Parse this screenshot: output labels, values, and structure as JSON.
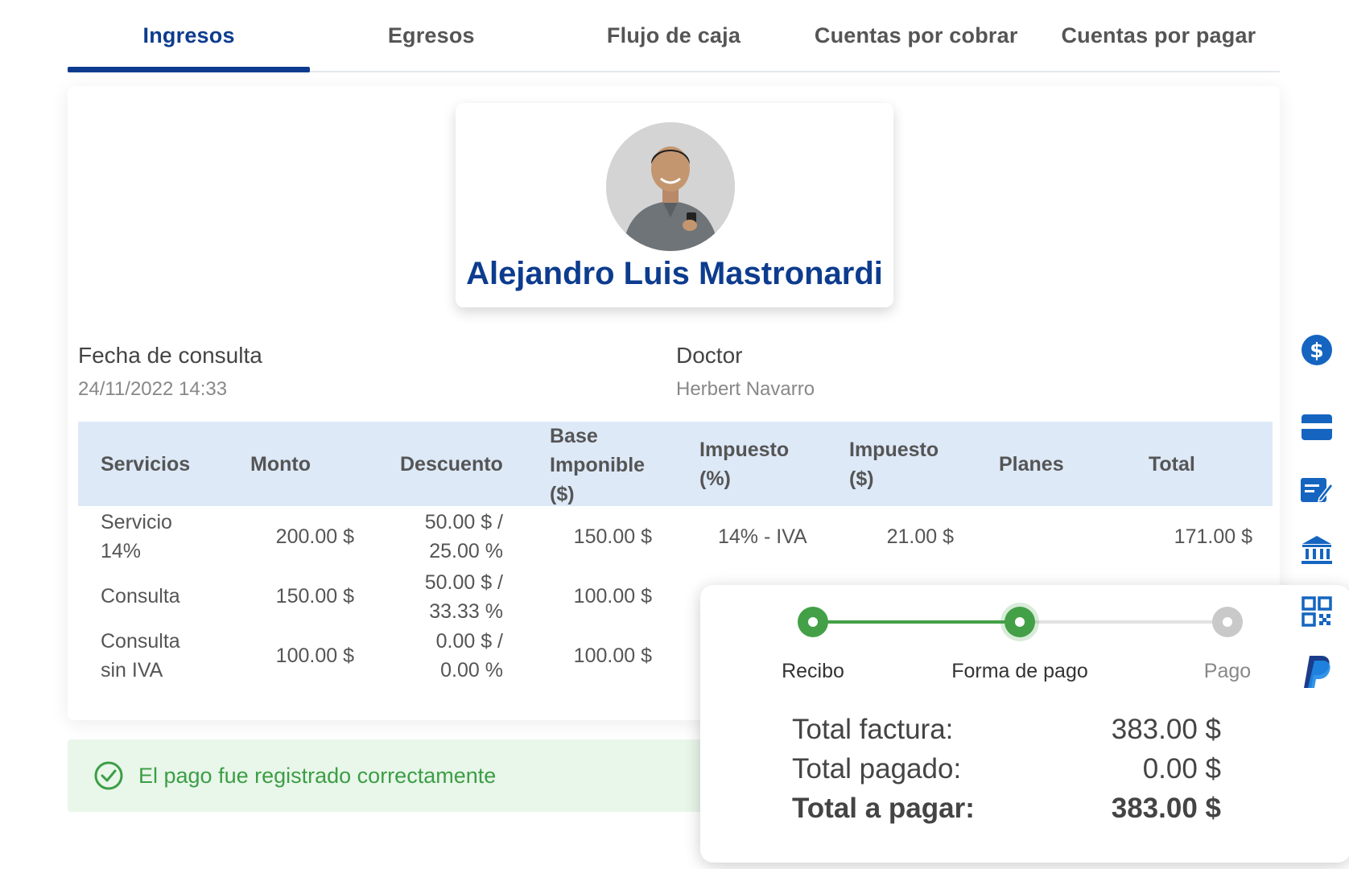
{
  "tabs": [
    {
      "label": "Ingresos",
      "active": true
    },
    {
      "label": "Egresos"
    },
    {
      "label": "Flujo de caja"
    },
    {
      "label": "Cuentas por cobrar"
    },
    {
      "label": "Cuentas por pagar"
    }
  ],
  "patient": {
    "name": "Alejandro Luis Mastronardi"
  },
  "consulta": {
    "fecha_label": "Fecha de consulta",
    "fecha_value": "24/11/2022 14:33",
    "doctor_label": "Doctor",
    "doctor_value": "Herbert Navarro"
  },
  "table": {
    "headers": {
      "servicios": "Servicios",
      "monto": "Monto",
      "descuento": "Descuento",
      "base_1": "Base",
      "base_2": "Imponible",
      "base_3": "($)",
      "imp_pct_1": "Impuesto",
      "imp_pct_2": "(%)",
      "imp_usd_1": "Impuesto",
      "imp_usd_2": "($)",
      "planes": "Planes",
      "total": "Total"
    },
    "rows": [
      {
        "serv_1": "Servicio",
        "serv_2": "14%",
        "monto": "200.00 $",
        "desc_1": "50.00 $ /",
        "desc_2": "25.00 %",
        "base": "150.00 $",
        "imp_pct": "14% - IVA",
        "imp_usd": "21.00 $",
        "total": "171.00 $"
      },
      {
        "serv_1": "Consulta",
        "monto": "150.00 $",
        "desc_1": "50.00 $ /",
        "desc_2": "33.33 %",
        "base": "100.00 $"
      },
      {
        "serv_1": "Consulta",
        "serv_2": "sin IVA",
        "monto": "100.00 $",
        "desc_1": "0.00 $ /",
        "desc_2": "0.00 %",
        "base": "100.00 $"
      }
    ]
  },
  "success": {
    "message": "El pago fue registrado correctamente"
  },
  "payment": {
    "steps": [
      {
        "label": "Recibo",
        "state": "done"
      },
      {
        "label": "Forma de pago",
        "state": "current"
      },
      {
        "label": "Pago",
        "state": "pending"
      }
    ],
    "total_factura_label": "Total factura:",
    "total_factura_value": "383.00 $",
    "total_pagado_label": "Total pagado:",
    "total_pagado_value": "0.00 $",
    "total_a_pagar_label": "Total a pagar:",
    "total_a_pagar_value": "383.00 $"
  },
  "side_icons": [
    "dollar-icon",
    "credit-card-icon",
    "check-edit-icon",
    "bank-icon",
    "qr-code-icon",
    "paypal-icon"
  ],
  "colors": {
    "primary": "#0d3c8e",
    "header_bg": "#dde9f7",
    "success": "#3b9e45",
    "step_green": "#43a047",
    "icon_blue": "#1565c0"
  }
}
